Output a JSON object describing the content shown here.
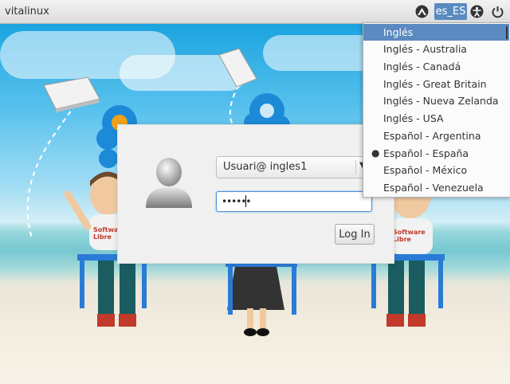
{
  "topbar": {
    "hostname": "vitalinux",
    "lang_button": "es_ES",
    "indicators": [
      "network-icon",
      "keyboard-layout",
      "accessibility-icon",
      "power-icon"
    ]
  },
  "login": {
    "user_combo_value": "Usuari@ ingles1",
    "password_masked": "••••••",
    "login_button": "Log In"
  },
  "language_menu": {
    "items": [
      {
        "label": "Inglés",
        "selected": true,
        "active": false
      },
      {
        "label": "Inglés - Australia",
        "selected": false,
        "active": false
      },
      {
        "label": "Inglés - Canadá",
        "selected": false,
        "active": false
      },
      {
        "label": "Inglés - Great Britain",
        "selected": false,
        "active": false
      },
      {
        "label": "Inglés - Nueva Zelanda",
        "selected": false,
        "active": false
      },
      {
        "label": "Inglés - USA",
        "selected": false,
        "active": false
      },
      {
        "label": "Español - Argentina",
        "selected": false,
        "active": false
      },
      {
        "label": "Español - España",
        "selected": false,
        "active": true
      },
      {
        "label": "Español - México",
        "selected": false,
        "active": false
      },
      {
        "label": "Español - Venezuela",
        "selected": false,
        "active": false
      }
    ]
  },
  "scene": {
    "shirt_text": "Software Libre"
  },
  "colors": {
    "accent": "#5a8ac0",
    "focus": "#4a90d9"
  }
}
